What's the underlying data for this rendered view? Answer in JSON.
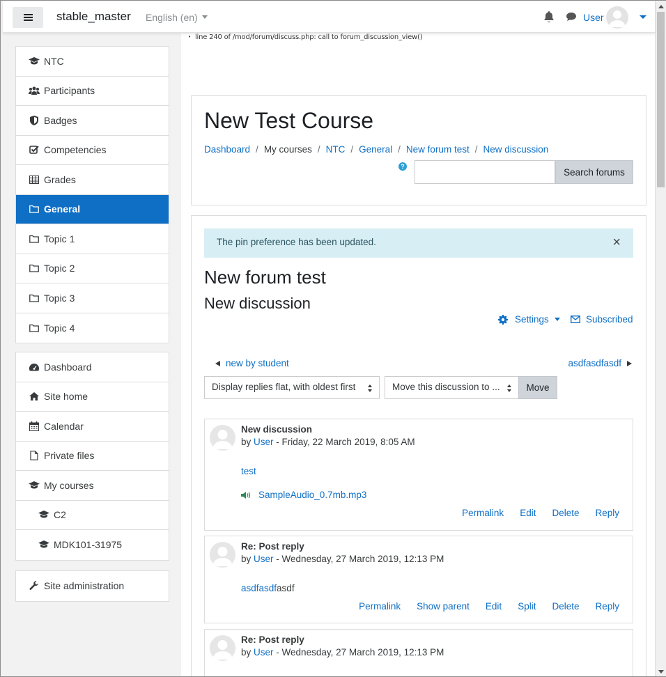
{
  "navbar": {
    "site_name": "stable_master",
    "language": "English (en)",
    "user_name": "User"
  },
  "debug_message": "line 240 of /mod/forum/discuss.php: call to forum_discussion_view()",
  "sidebar": {
    "course_nav": [
      {
        "label": "NTC",
        "icon": "graduation-cap-icon"
      },
      {
        "label": "Participants",
        "icon": "users-icon"
      },
      {
        "label": "Badges",
        "icon": "shield-icon"
      },
      {
        "label": "Competencies",
        "icon": "check-square-icon"
      },
      {
        "label": "Grades",
        "icon": "table-icon"
      },
      {
        "label": "General",
        "icon": "folder-icon",
        "active": true
      },
      {
        "label": "Topic 1",
        "icon": "folder-icon"
      },
      {
        "label": "Topic 2",
        "icon": "folder-icon"
      },
      {
        "label": "Topic 3",
        "icon": "folder-icon"
      },
      {
        "label": "Topic 4",
        "icon": "folder-icon"
      }
    ],
    "site_nav": [
      {
        "label": "Dashboard",
        "icon": "dashboard-icon"
      },
      {
        "label": "Site home",
        "icon": "home-icon"
      },
      {
        "label": "Calendar",
        "icon": "calendar-icon"
      },
      {
        "label": "Private files",
        "icon": "file-icon"
      },
      {
        "label": "My courses",
        "icon": "graduation-cap-icon"
      },
      {
        "label": "C2",
        "icon": "graduation-cap-icon",
        "sub": true
      },
      {
        "label": "MDK101-31975",
        "icon": "graduation-cap-icon",
        "sub": true
      }
    ],
    "admin": {
      "label": "Site administration",
      "icon": "wrench-icon"
    }
  },
  "header": {
    "course_title": "New Test Course",
    "breadcrumb": [
      "Dashboard",
      "My courses",
      "NTC",
      "General",
      "New forum test",
      "New discussion"
    ],
    "search_button": "Search forums",
    "search_value": ""
  },
  "alert": {
    "message": "The pin preference has been updated.",
    "close": "×"
  },
  "forum": {
    "title": "New forum test",
    "discussion_title": "New discussion",
    "settings_label": "Settings",
    "subscribed_label": "Subscribed",
    "prev_discussion": "new by student",
    "next_discussion": "asdfasdfasdf",
    "display_mode": "Display replies flat, with oldest first",
    "move_select": "Move this discussion to ...",
    "move_button": "Move"
  },
  "posts": [
    {
      "subject": "New discussion",
      "by": "by",
      "author": "User",
      "date": " - Friday, 22 March 2019, 8:05 AM",
      "body_link": "test",
      "attachment": "SampleAudio_0.7mb.mp3",
      "actions": [
        "Permalink",
        "Edit",
        "Delete",
        "Reply"
      ]
    },
    {
      "subject": "Re: Post reply",
      "by": "by",
      "author": "User",
      "date": " - Wednesday, 27 March 2019, 12:13 PM",
      "body_link": "asdfasdf",
      "body_text": "asdf",
      "actions": [
        "Permalink",
        "Show parent",
        "Edit",
        "Split",
        "Delete",
        "Reply"
      ]
    },
    {
      "subject": "Re: Post reply",
      "by": "by",
      "author": "User",
      "date": " - Wednesday, 27 March 2019, 12:13 PM"
    }
  ],
  "colors": {
    "brand": "#0f6fc5",
    "alert_bg": "#d7eef4",
    "button_gray": "#ced4da"
  }
}
